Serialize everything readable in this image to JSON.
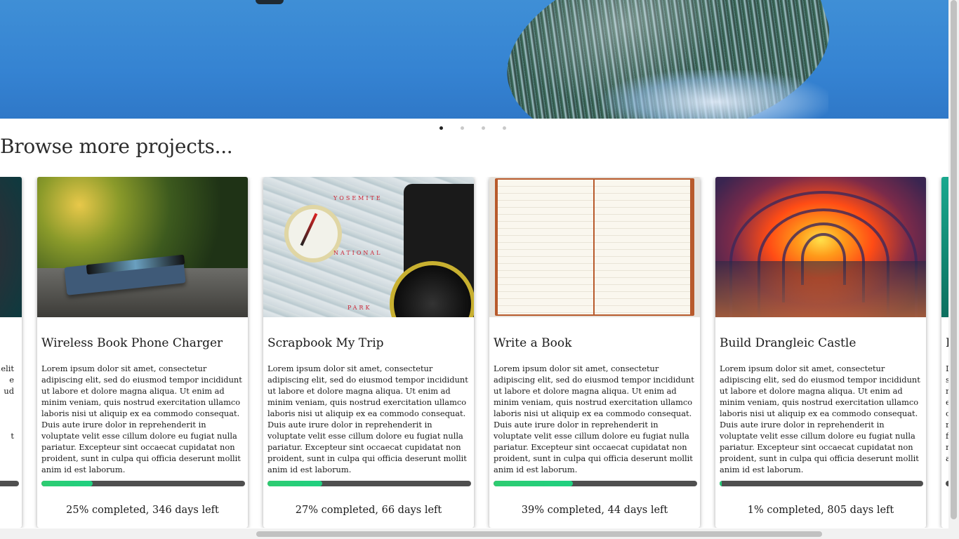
{
  "carousel": {
    "slides": 4,
    "active_index": 0
  },
  "section": {
    "title": "Browse more projects..."
  },
  "projects": [
    {
      "title": "Wireless Book Phone Charger",
      "description": "Lorem ipsum dolor sit amet, consectetur adipiscing elit, sed do eiusmod tempor incididunt ut labore et dolore magna aliqua. Ut enim ad minim veniam, quis nostrud exercitation ullamco laboris nisi ut aliquip ex ea commodo consequat. Duis aute irure dolor in reprehenderit in voluptate velit esse cillum dolore eu fugiat nulla pariatur. Excepteur sint occaecat cupidatat non proident, sunt in culpa qui officia deserunt mollit anim id est laborum.",
      "progress": 0.25,
      "status": "25% completed, 346 days left"
    },
    {
      "title": "Scrapbook My Trip",
      "description": "Lorem ipsum dolor sit amet, consectetur adipiscing elit, sed do eiusmod tempor incididunt ut labore et dolore magna aliqua. Ut enim ad minim veniam, quis nostrud exercitation ullamco laboris nisi ut aliquip ex ea commodo consequat. Duis aute irure dolor in reprehenderit in voluptate velit esse cillum dolore eu fugiat nulla pariatur. Excepteur sint occaecat cupidatat non proident, sunt in culpa qui officia deserunt mollit anim id est laborum.",
      "progress": 0.27,
      "status": "27% completed, 66 days left",
      "map_labels": [
        "YOSEMITE",
        "NATIONAL",
        "PARK"
      ]
    },
    {
      "title": "Write a Book",
      "description": "Lorem ipsum dolor sit amet, consectetur adipiscing elit, sed do eiusmod tempor incididunt ut labore et dolore magna aliqua. Ut enim ad minim veniam, quis nostrud exercitation ullamco laboris nisi ut aliquip ex ea commodo consequat. Duis aute irure dolor in reprehenderit in voluptate velit esse cillum dolore eu fugiat nulla pariatur. Excepteur sint occaecat cupidatat non proident, sunt in culpa qui officia deserunt mollit anim id est laborum.",
      "progress": 0.39,
      "status": "39% completed, 44 days left"
    },
    {
      "title": "Build Drangleic Castle",
      "description": "Lorem ipsum dolor sit amet, consectetur adipiscing elit, sed do eiusmod tempor incididunt ut labore et dolore magna aliqua. Ut enim ad minim veniam, quis nostrud exercitation ullamco laboris nisi ut aliquip ex ea commodo consequat. Duis aute irure dolor in reprehenderit in voluptate velit esse cillum dolore eu fugiat nulla pariatur. Excepteur sint occaecat cupidatat non proident, sunt in culpa qui officia deserunt mollit anim id est laborum.",
      "progress": 0.01,
      "status": "1% completed, 805 days left"
    }
  ],
  "partial_left": {
    "fragments": [
      "elit,",
      "e",
      "ud",
      "",
      "",
      "",
      "t"
    ]
  },
  "partial_right": {
    "title": "F",
    "fragments": [
      "L",
      "s",
      "n",
      "e",
      "c",
      "r",
      "f",
      "n",
      "a"
    ]
  },
  "colors": {
    "progress_fill": "#2ecc71",
    "progress_track": "#4f4f4f"
  }
}
